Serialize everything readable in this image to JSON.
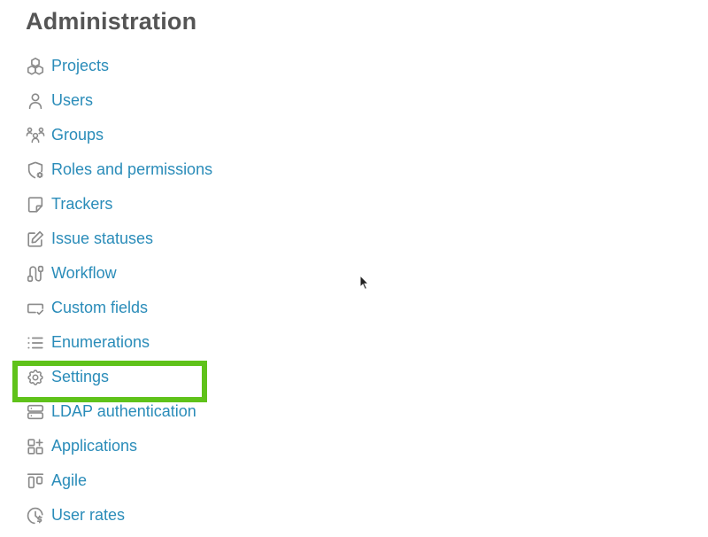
{
  "page": {
    "title": "Administration"
  },
  "menu": {
    "items": [
      {
        "label": "Projects",
        "icon": "projects-icon"
      },
      {
        "label": "Users",
        "icon": "user-icon"
      },
      {
        "label": "Groups",
        "icon": "groups-icon"
      },
      {
        "label": "Roles and permissions",
        "icon": "shield-gear-icon"
      },
      {
        "label": "Trackers",
        "icon": "sticky-note-icon"
      },
      {
        "label": "Issue statuses",
        "icon": "edit-icon"
      },
      {
        "label": "Workflow",
        "icon": "workflow-icon"
      },
      {
        "label": "Custom fields",
        "icon": "custom-field-icon"
      },
      {
        "label": "Enumerations",
        "icon": "list-icon"
      },
      {
        "label": "Settings",
        "icon": "gear-icon"
      },
      {
        "label": "LDAP authentication",
        "icon": "server-icon"
      },
      {
        "label": "Applications",
        "icon": "apps-icon"
      },
      {
        "label": "Agile",
        "icon": "agile-board-icon"
      },
      {
        "label": "User rates",
        "icon": "clock-dollar-icon"
      }
    ],
    "highlighted_item": "Settings"
  },
  "colors": {
    "link": "#2a8cb9",
    "icon": "#8a8a8a",
    "title": "#555555",
    "highlight": "#5fc21a"
  }
}
